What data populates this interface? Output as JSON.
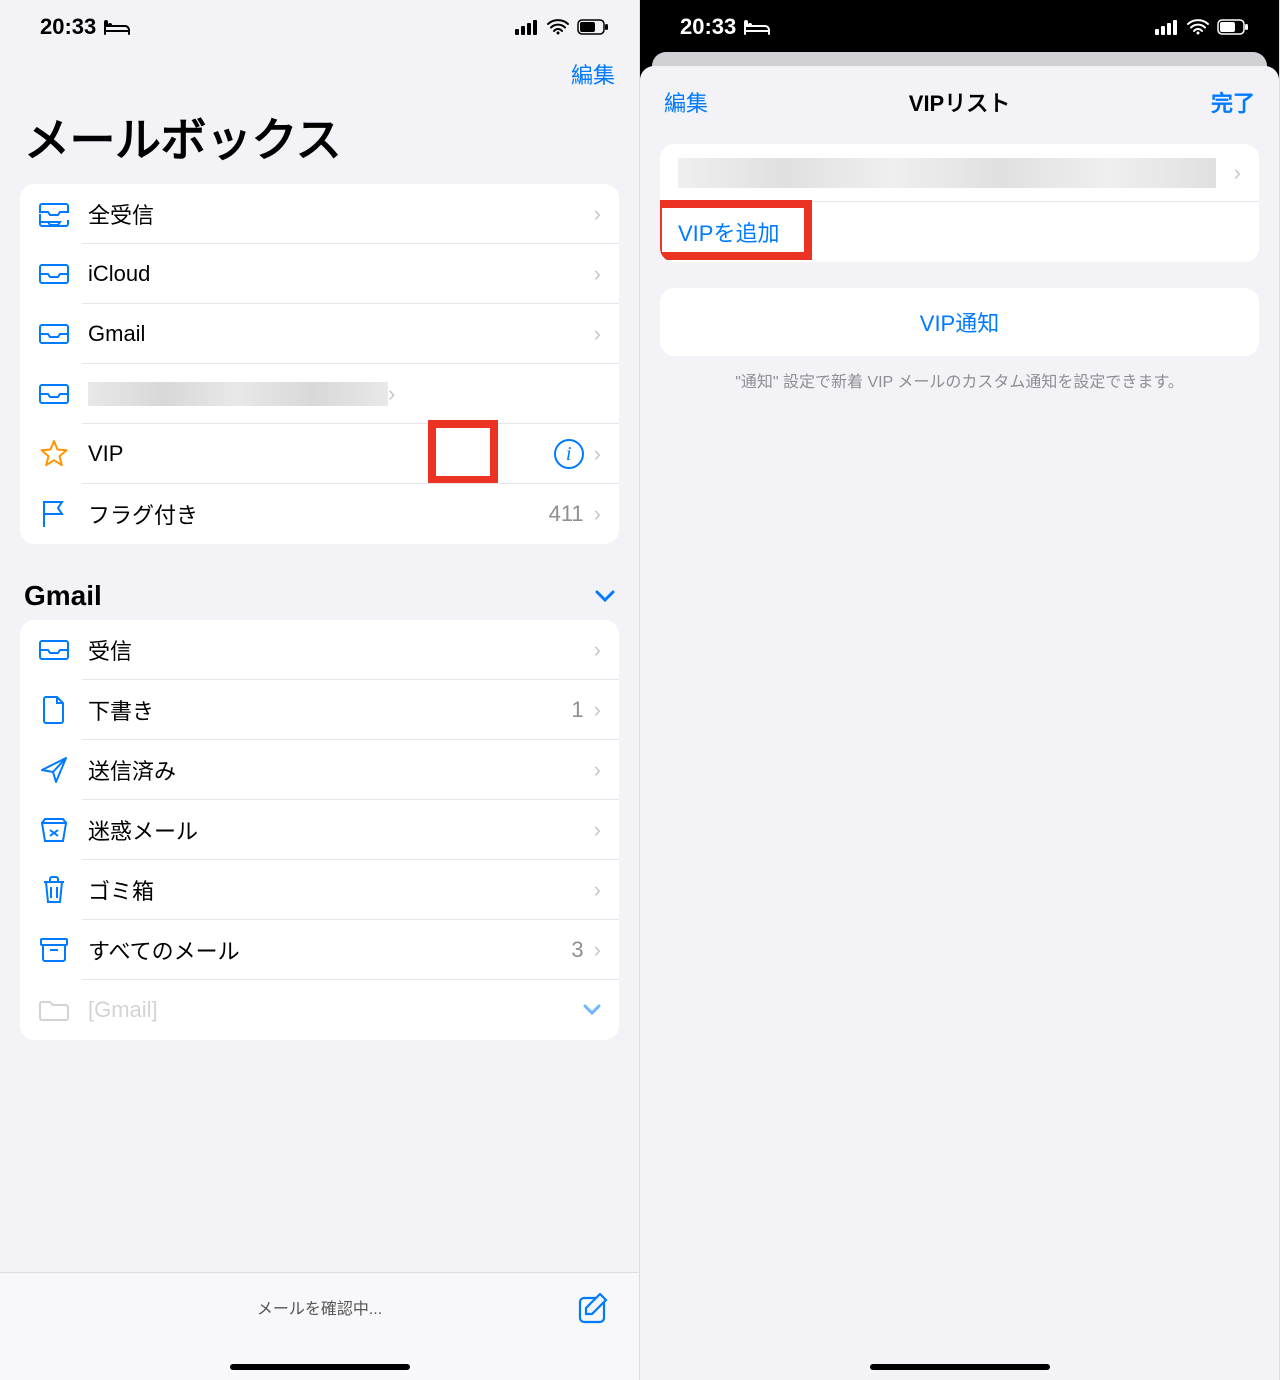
{
  "status": {
    "time": "20:33"
  },
  "left": {
    "edit": "編集",
    "title": "メールボックス",
    "mailboxes": [
      {
        "icon": "tray-full",
        "label": "全受信"
      },
      {
        "icon": "tray",
        "label": "iCloud"
      },
      {
        "icon": "tray",
        "label": "Gmail"
      },
      {
        "icon": "tray",
        "label": "",
        "redacted": true
      },
      {
        "icon": "star",
        "label": "VIP",
        "info": true
      },
      {
        "icon": "flag",
        "label": "フラグ付き",
        "count": "411"
      }
    ],
    "section": {
      "title": "Gmail"
    },
    "gmail": [
      {
        "icon": "tray",
        "label": "受信"
      },
      {
        "icon": "doc",
        "label": "下書き",
        "count": "1"
      },
      {
        "icon": "paperplane",
        "label": "送信済み"
      },
      {
        "icon": "junk",
        "label": "迷惑メール"
      },
      {
        "icon": "trash",
        "label": "ゴミ箱"
      },
      {
        "icon": "archive",
        "label": "すべてのメール",
        "count": "3"
      },
      {
        "icon": "folder",
        "label": "[Gmail]",
        "expandable": true,
        "gray": true
      }
    ],
    "toolbar": "メールを確認中..."
  },
  "right": {
    "edit": "編集",
    "title": "VIPリスト",
    "done": "完了",
    "add_vip": "VIPを追加",
    "vip_notif": "VIP通知",
    "footer": "\"通知\" 設定で新着 VIP メールのカスタム通知を設定できます。"
  }
}
